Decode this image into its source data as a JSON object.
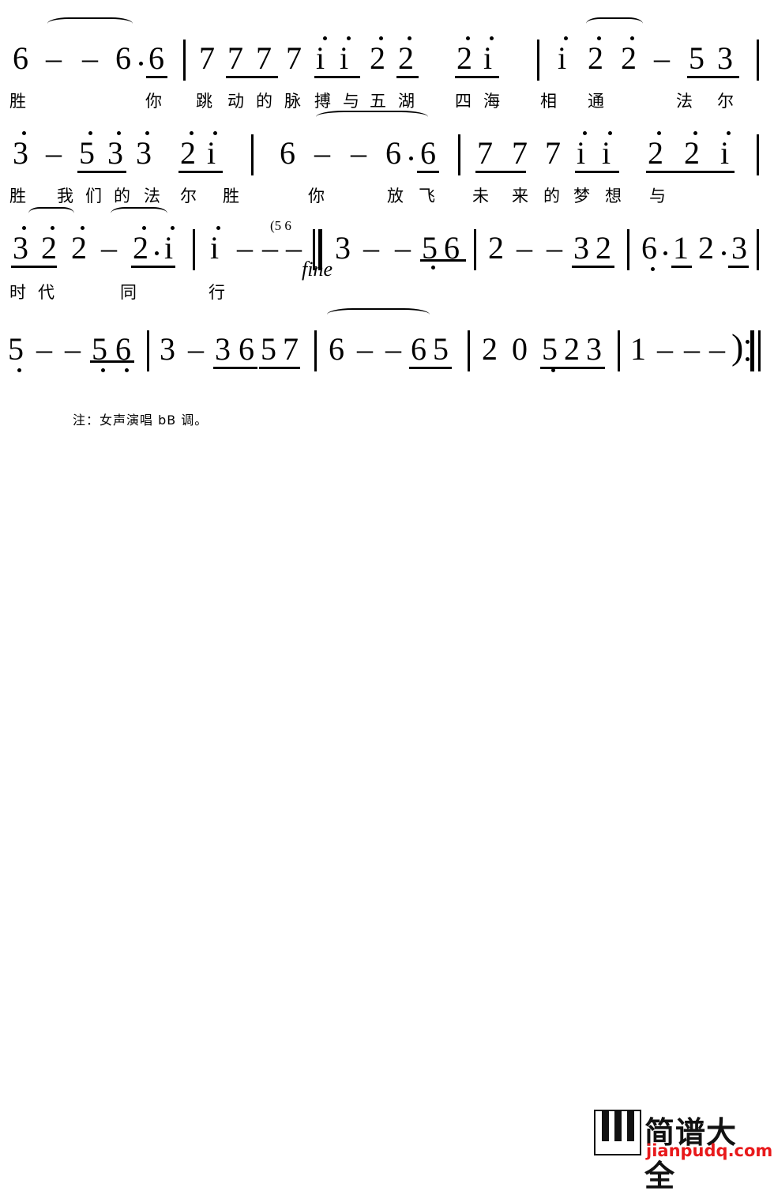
{
  "document": {
    "type": "numbered-musical-notation",
    "note_text": "注：女声演唱 bB 调。",
    "fine_marker": "fine",
    "tiny_marker": "(5 6",
    "systems": [
      {
        "id": "system-1",
        "notes": "6 - - 6·6 | 7 7 7 7 i i 2 2 2 i | i 2 2 - 5 3",
        "lyrics": "胜　　　你　跳动的脉搏与五湖四海　相通　　法尔"
      },
      {
        "id": "system-2",
        "notes": "3 - 5 3 3 2 i | 6 - - 6·6 | 7 7 7 i i 2 2 i",
        "lyrics": "胜　我们的法尔　胜　　　你　放飞未来的梦想与"
      },
      {
        "id": "system-3",
        "notes": "3 2 2 - 2·i | i - - - ‖ 3 - - 5 6 | 2 - - 3 2 | 6·1 2·3",
        "lyrics": "时代　同　行"
      },
      {
        "id": "system-4",
        "notes": "5 - - 5 6 | 3 - 3 6 5 7 | 6 - - 6 5 | 2 0 5 2 3 | 1 - - - )‖",
        "lyrics": ""
      }
    ]
  },
  "watermark": {
    "title": "简谱大全",
    "url": "jianpudq.com",
    "icon": "piano-keys-icon",
    "accent_color": "#e8191b"
  }
}
